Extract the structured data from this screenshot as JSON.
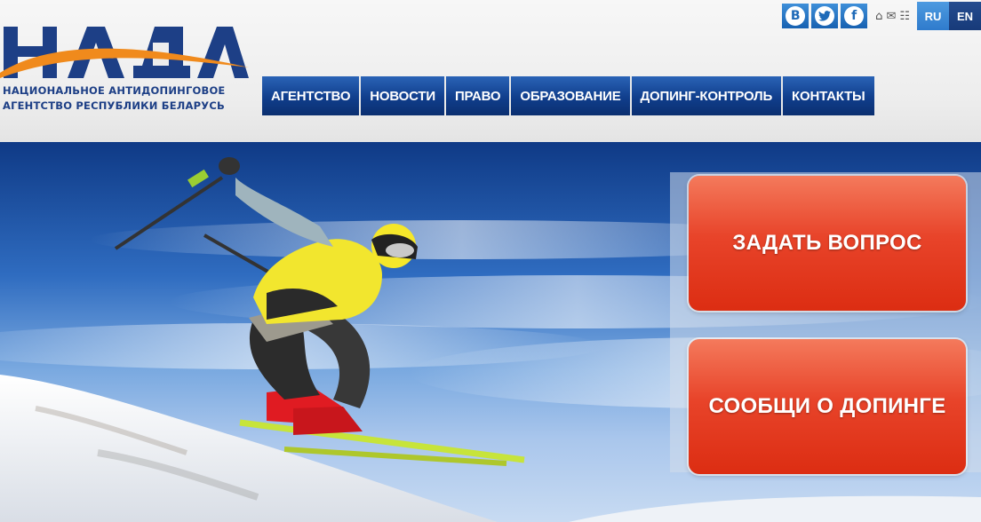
{
  "header": {
    "logo_text": [
      "Национальное антидопинговое",
      "агентство Республики Беларусь"
    ],
    "social_icons": [
      "vk-icon",
      "twitter-icon",
      "facebook-icon"
    ],
    "social_glyphs": [
      "B",
      "t",
      "f"
    ],
    "utility_icons": [
      "home-icon",
      "mail-icon",
      "sitemap-icon"
    ],
    "languages": [
      "RU",
      "EN"
    ],
    "active_language": "RU"
  },
  "nav": {
    "items": [
      "АГЕНТСТВО",
      "НОВОСТИ",
      "ПРАВО",
      "ОБРАЗОВАНИЕ",
      "ДОПИНГ-КОНТРОЛЬ",
      "КОНТАКТЫ"
    ]
  },
  "hero": {
    "cta_ask": "ЗАДАТЬ ВОПРОС",
    "cta_report": "СООБЩИ О ДОПИНГЕ"
  },
  "colors": {
    "brand_blue": "#1d3f86",
    "nav_blue": "#103e8c",
    "cta_red": "#e8442a",
    "logo_orange": "#f08a1c"
  }
}
